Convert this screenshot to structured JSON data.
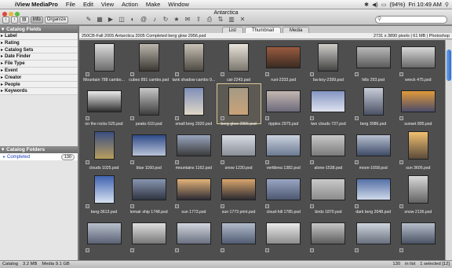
{
  "menubar": {
    "items": [
      "iView MediaPro",
      "File",
      "Edit",
      "View",
      "Action",
      "Make",
      "Window"
    ],
    "battery": "(94%)",
    "clock": "Fri 10:49 AM"
  },
  "window": {
    "title": "Antarctica",
    "info_label": "Info",
    "organize_label": "Organize",
    "search_placeholder": ""
  },
  "sidebar": {
    "catalog_fields_title": "Catalog Fields",
    "fields": [
      "Label",
      "Rating",
      "Catalog Sets",
      "Date Finder",
      "File Type",
      "Event",
      "Creator",
      "People",
      "Keywords"
    ],
    "catalog_folders_title": "Catalog Folders",
    "folder": {
      "name": "Completed",
      "count": "130"
    }
  },
  "tabs": [
    "List",
    "Thumbnail",
    "Media"
  ],
  "active_tab": "Thumbnail",
  "info_bar": {
    "left": "250CB-Fall 2005 Antarctica 2005 Completed berg glow 2956.psd",
    "right": "2731 x 3890 pixels | 61 MB | Photoshop"
  },
  "thumbnails": [
    {
      "label": "Mountain 788 cambo...",
      "shape": "p",
      "colors": [
        "#dcdcdc",
        "#6b6b6b"
      ]
    },
    {
      "label": "cubes 891 cambo.psd",
      "shape": "p",
      "colors": [
        "#bcb7ad",
        "#3b3833"
      ]
    },
    {
      "label": "tank shadow cambo 9...",
      "shape": "p",
      "colors": [
        "#c9c2b6",
        "#4e4a43"
      ]
    },
    {
      "label": "cat-2243.psd",
      "shape": "p",
      "colors": [
        "#e8e4dc",
        "#7b766e"
      ]
    },
    {
      "label": "rust-2333.psd",
      "shape": "l",
      "colors": [
        "#9a5b3f",
        "#3a2b22"
      ]
    },
    {
      "label": "ba-boy-2399.psd",
      "shape": "p",
      "colors": [
        "#d0cdc8",
        "#444"
      ]
    },
    {
      "label": "hills 293.psd",
      "shape": "l",
      "colors": [
        "#b9b9b9",
        "#5a5a5a"
      ]
    },
    {
      "label": "wreck 475.psd",
      "shape": "l",
      "colors": [
        "#d8d8d8",
        "#6a6a6a"
      ]
    },
    {
      "label": "on the rocks 525.psd",
      "shape": "l",
      "colors": [
        "#ececec",
        "#2e2e2e"
      ]
    },
    {
      "label": "peaks 610.psd",
      "shape": "p",
      "colors": [
        "#c8c8c8",
        "#3d3d3d"
      ]
    },
    {
      "label": "small berg 2920.psd",
      "shape": "p",
      "colors": [
        "#7f8fb8",
        "#e0d8c8"
      ]
    },
    {
      "label": "berg glow 2956.psd",
      "shape": "p",
      "colors": [
        "#a59a84",
        "#c9a27a"
      ],
      "selected": true
    },
    {
      "label": "ripples 2975.psd",
      "shape": "l",
      "colors": [
        "#c3b7b1",
        "#6d6a7a"
      ]
    },
    {
      "label": "two clouds 737.psd",
      "shape": "l",
      "colors": [
        "#8294c1",
        "#dfe3ef"
      ]
    },
    {
      "label": "berg 3086.psd",
      "shape": "p",
      "colors": [
        "#c8cdd8",
        "#4b5265"
      ]
    },
    {
      "label": "sunset 895.psd",
      "shape": "l",
      "colors": [
        "#e09a3a",
        "#4b4b6a"
      ]
    },
    {
      "label": "clouds 1025.psd",
      "shape": "p",
      "colors": [
        "#3b4f83",
        "#b89e5e"
      ]
    },
    {
      "label": "blue 1160.psd",
      "shape": "l",
      "colors": [
        "#2e4a88",
        "#b9c3d8"
      ]
    },
    {
      "label": "mountains 1162.psd",
      "shape": "l",
      "colors": [
        "#9aa6bf",
        "#3b3b3b"
      ]
    },
    {
      "label": "snow 1230.psd",
      "shape": "l",
      "colors": [
        "#d7dbe2",
        "#8a8f98"
      ]
    },
    {
      "label": "vertibrea 1382.psd",
      "shape": "l",
      "colors": [
        "#cbd2de",
        "#6c7a93"
      ]
    },
    {
      "label": "alone-1538.psd",
      "shape": "l",
      "colors": [
        "#c9c9c9",
        "#7a7a7a"
      ]
    },
    {
      "label": "moon-1658.psd",
      "shape": "l",
      "colors": [
        "#b8c1d2",
        "#3e4b66"
      ]
    },
    {
      "label": "sun 3606.psd",
      "shape": "p",
      "colors": [
        "#f0c070",
        "#5b4a3a"
      ]
    },
    {
      "label": "berg-3613.psd",
      "shape": "p",
      "colors": [
        "#3f62b0",
        "#d7e3f2"
      ]
    },
    {
      "label": "lemair ship 1748.psd",
      "shape": "l",
      "colors": [
        "#8895b0",
        "#2f3542"
      ]
    },
    {
      "label": "sun 1773.psd",
      "shape": "l",
      "colors": [
        "#e4b47a",
        "#2d2b33"
      ]
    },
    {
      "label": "sun 1773 print.psd",
      "shape": "l",
      "colors": [
        "#d9a66d",
        "#2b2a30"
      ]
    },
    {
      "label": "cloud-hill 1785.psd",
      "shape": "l",
      "colors": [
        "#9aa6c4",
        "#4d5770"
      ]
    },
    {
      "label": "birds 1870.psd",
      "shape": "l",
      "colors": [
        "#c9c9c9",
        "#8b8b8b"
      ]
    },
    {
      "label": "dark berg 2048.psd",
      "shape": "l",
      "colors": [
        "#5470a6",
        "#cfd9ea"
      ]
    },
    {
      "label": "snow 2136.psd",
      "shape": "p",
      "colors": [
        "#d9d9d9",
        "#636363"
      ]
    },
    {
      "label": "",
      "shape": "l",
      "colors": [
        "#b9c0cc",
        "#5a6174"
      ]
    },
    {
      "label": "",
      "shape": "l",
      "colors": [
        "#e0e0e0",
        "#777"
      ]
    },
    {
      "label": "",
      "shape": "l",
      "colors": [
        "#d2d6de",
        "#6a7080"
      ]
    },
    {
      "label": "",
      "shape": "l",
      "colors": [
        "#b3bccc",
        "#515c72"
      ]
    },
    {
      "label": "",
      "shape": "l",
      "colors": [
        "#eaeaea",
        "#8d8d8d"
      ]
    },
    {
      "label": "",
      "shape": "l",
      "colors": [
        "#c7c7c7",
        "#5e5e5e"
      ]
    },
    {
      "label": "",
      "shape": "l",
      "colors": [
        "#cfd5de",
        "#69717e"
      ]
    },
    {
      "label": "",
      "shape": "l",
      "colors": [
        "#b7bfcc",
        "#4a5364"
      ]
    }
  ],
  "statusbar": {
    "catalog": "Catalog",
    "size": "3.2 MB",
    "media": "Media 9.1 GB",
    "list_count": "130",
    "in_list": "in list",
    "selected": "1 selected [12]"
  }
}
